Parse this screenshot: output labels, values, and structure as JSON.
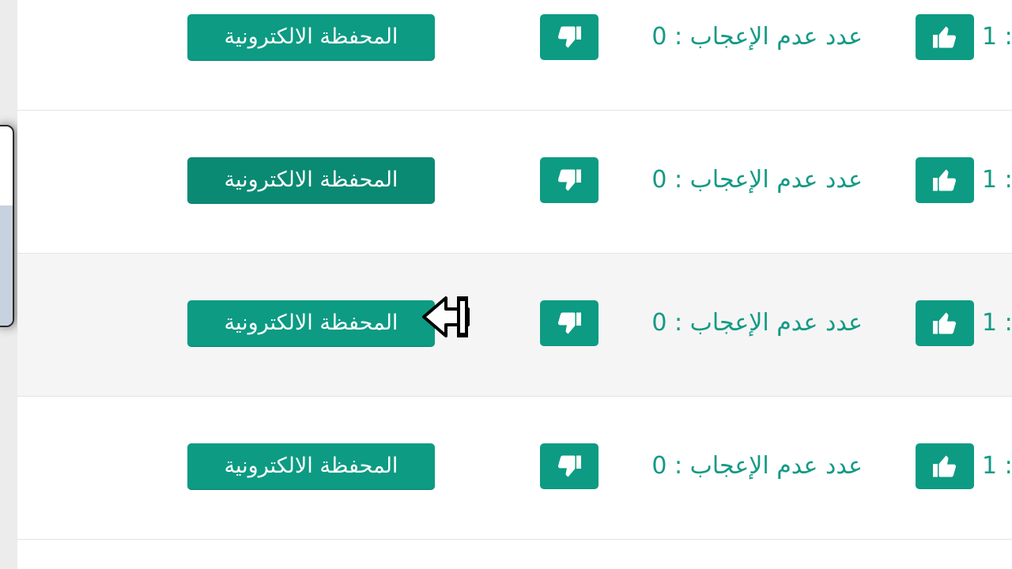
{
  "rows": [
    {
      "wallet_label": "المحفظة الالكترونية",
      "dislike_text": "عدد عدم الإعجاب : 0",
      "like_text": "1 :"
    },
    {
      "wallet_label": "المحفظة الالكترونية",
      "dislike_text": "عدد عدم الإعجاب : 0",
      "like_text": "1 :"
    },
    {
      "wallet_label": "المحفظة الالكترونية",
      "dislike_text": "عدد عدم الإعجاب : 0",
      "like_text": "1 :"
    },
    {
      "wallet_label": "المحفظة الالكترونية",
      "dislike_text": "عدد عدم الإعجاب : 0",
      "like_text": "1 :"
    }
  ],
  "icons": {
    "like": "thumbs-up-icon",
    "dislike": "thumbs-down-icon",
    "cursor": "pointer-cursor-icon"
  },
  "colors": {
    "accent": "#0d9b83",
    "text_accent": "#139a85"
  }
}
